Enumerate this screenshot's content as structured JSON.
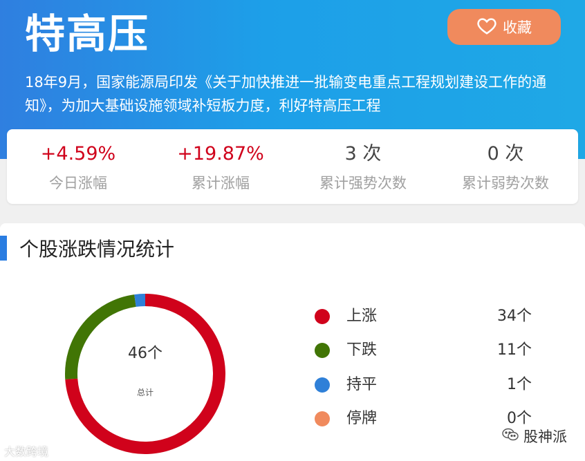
{
  "header": {
    "title": "特高压",
    "favorite_label": "收藏",
    "description": "18年9月，国家能源局印发《关于加快推进一批输变电重点工程规划建设工作的通知》，为加大基础设施领域补短板力度，利好特高压工程"
  },
  "stats": [
    {
      "value": "+4.59%",
      "label": "今日涨幅"
    },
    {
      "value": "+19.87%",
      "label": "累计涨幅"
    },
    {
      "value": "3 次",
      "label": "累计强势次数"
    },
    {
      "value": "0 次",
      "label": "累计弱势次数"
    }
  ],
  "section": {
    "title": "个股涨跌情况统计",
    "total": "46个",
    "total_label": "总计"
  },
  "legend": [
    {
      "label": "上涨",
      "count": "34个",
      "value": 34,
      "color": "#d0021b"
    },
    {
      "label": "下跌",
      "count": "11个",
      "value": 11,
      "color": "#417505"
    },
    {
      "label": "持平",
      "count": "1个",
      "value": 1,
      "color": "#2f80d8"
    },
    {
      "label": "停牌",
      "count": "0个",
      "value": 0,
      "color": "#f08a5d"
    }
  ],
  "watermarks": {
    "left": "大数跨境",
    "right": "股神派"
  },
  "icons": {
    "favorite": "heart-icon",
    "wechat": "wechat-icon"
  }
}
